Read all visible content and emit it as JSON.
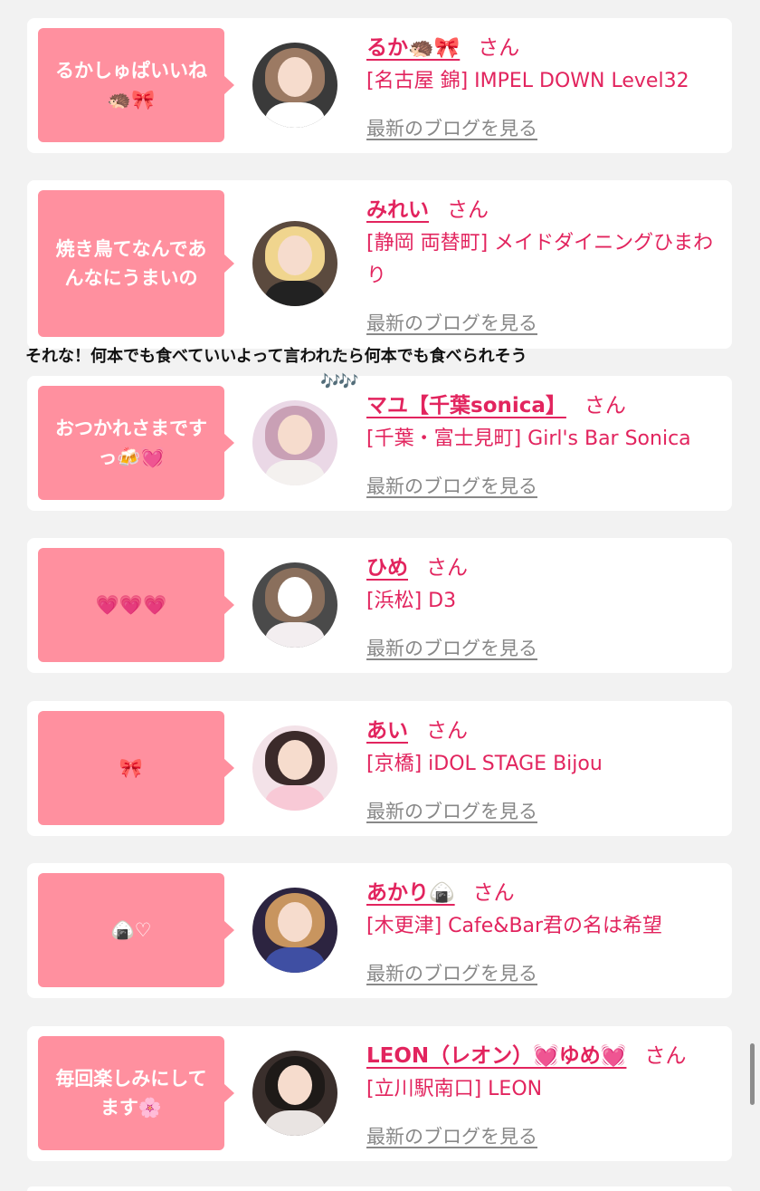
{
  "san_suffix": "さん",
  "blog_link_label": "最新のブログを見る",
  "overlay_comment": {
    "text": "それな！何本でも食べていいよって言われたら何本でも食べられそう",
    "notes": "🎶🎶"
  },
  "entries": [
    {
      "bubble": "るかしゅぱいいね🦔🎀",
      "name": "るか🦔🎀",
      "shop": "[名古屋 錦] IMPEL DOWN Level32"
    },
    {
      "bubble": "焼き鳥てなんであんなにうまいの",
      "name": "みれい",
      "shop": "[静岡 両替町] メイドダイニングひまわり"
    },
    {
      "bubble": "おつかれさまですっ🍻💓",
      "name": "マユ【千葉sonica】",
      "shop": "[千葉・富士見町] Girl's Bar Sonica"
    },
    {
      "bubble": "💗💗💗",
      "name": "ひめ",
      "shop": "[浜松] D3"
    },
    {
      "bubble": "🎀",
      "name": "あい",
      "shop": "[京橋] iDOL STAGE Bijou"
    },
    {
      "bubble": "🍙♡",
      "name": "あかり🍙",
      "shop": "[木更津] Cafe&Bar君の名は希望"
    },
    {
      "bubble": "毎回楽しみにしてます🌸",
      "name": "LEON（レオン）💓ゆめ💓",
      "shop": "[立川駅南口] LEON"
    }
  ],
  "colors": {
    "accent": "#e2245e",
    "bubble": "#ff909f",
    "background": "#f2f2f2",
    "link_gray": "#888888"
  },
  "icons": [
    "speech-bubble-pointer",
    "avatar-photo",
    "scrollbar-thumb"
  ]
}
